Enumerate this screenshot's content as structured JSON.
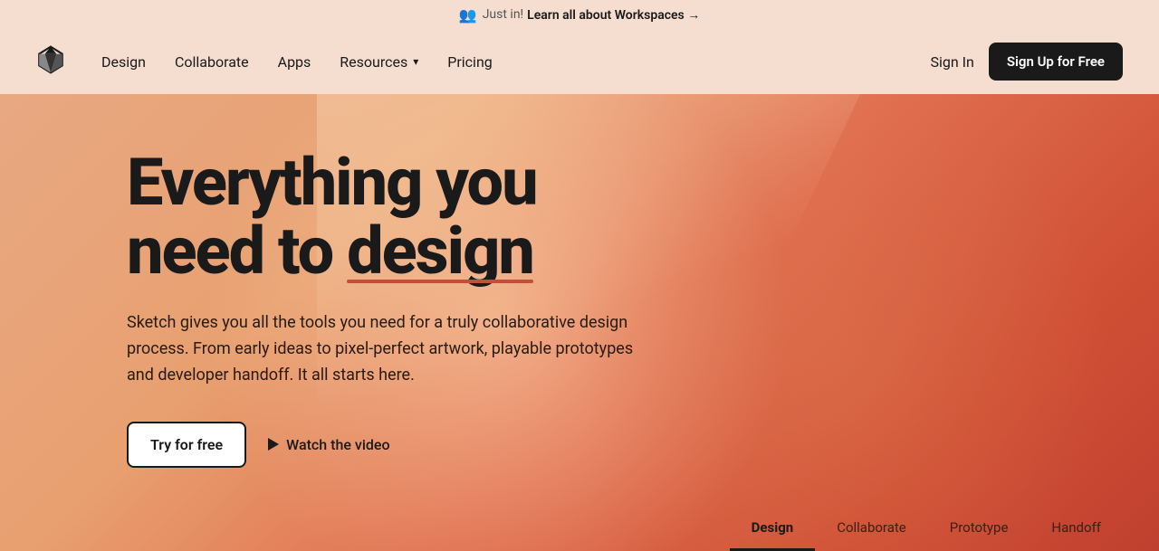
{
  "announcement": {
    "just_in_label": "Just in!",
    "learn_link": "Learn all about Workspaces →"
  },
  "nav": {
    "logo_alt": "Sketch logo",
    "links": [
      {
        "label": "Design",
        "has_dropdown": false
      },
      {
        "label": "Collaborate",
        "has_dropdown": false
      },
      {
        "label": "Apps",
        "has_dropdown": false
      },
      {
        "label": "Resources",
        "has_dropdown": true
      },
      {
        "label": "Pricing",
        "has_dropdown": false
      }
    ],
    "sign_in_label": "Sign In",
    "sign_up_label": "Sign Up for Free"
  },
  "hero": {
    "title_line1": "Everything you",
    "title_line2": "need to ",
    "title_highlight": "design",
    "description": "Sketch gives you all the tools you need for a truly collaborative design process. From early ideas to pixel-perfect artwork, playable prototypes and developer handoff. It all starts here.",
    "try_button": "Try for free",
    "watch_video_button": "Watch the video"
  },
  "bottom_tabs": [
    {
      "label": "Design",
      "active": true
    },
    {
      "label": "Collaborate",
      "active": false
    },
    {
      "label": "Prototype",
      "active": false
    },
    {
      "label": "Handoff",
      "active": false
    }
  ]
}
